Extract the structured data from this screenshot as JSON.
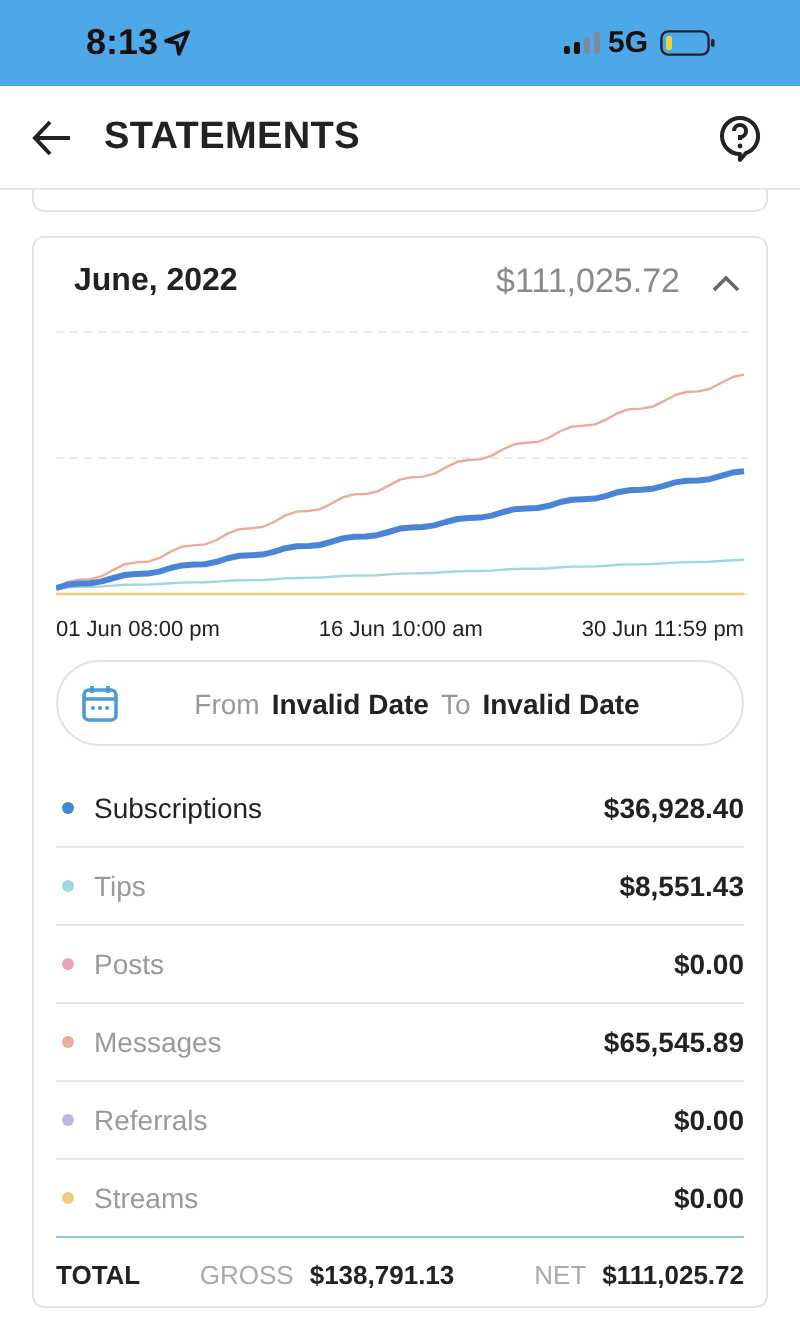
{
  "status_bar": {
    "time": "8:13",
    "network": "5G"
  },
  "header": {
    "title": "STATEMENTS"
  },
  "statement": {
    "month": "June, 2022",
    "amount": "$111,025.72",
    "expanded": true,
    "chart": {
      "kind": "picture",
      "x_labels": [
        "01 Jun 08:00 pm",
        "16 Jun 10:00 am",
        "30 Jun 11:59 pm"
      ]
    },
    "date_range": {
      "from_label": "From",
      "from_value": "Invalid Date",
      "to_label": "To",
      "to_value": "Invalid Date"
    },
    "categories": [
      {
        "name": "Subscriptions",
        "amount": "$36,928.40",
        "color": "#4a84d6",
        "selected": true
      },
      {
        "name": "Tips",
        "amount": "$8,551.43",
        "color": "#9fd8de",
        "selected": false
      },
      {
        "name": "Posts",
        "amount": "$0.00",
        "color": "#e8a6ba",
        "selected": false
      },
      {
        "name": "Messages",
        "amount": "$65,545.89",
        "color": "#eeab9c",
        "selected": false
      },
      {
        "name": "Referrals",
        "amount": "$0.00",
        "color": "#bcb8de",
        "selected": false
      },
      {
        "name": "Streams",
        "amount": "$0.00",
        "color": "#f3c97e",
        "selected": false
      }
    ],
    "total": {
      "label": "TOTAL",
      "gross_label": "GROSS",
      "gross": "$138,791.13",
      "net_label": "NET",
      "net": "$111,025.72"
    }
  }
}
